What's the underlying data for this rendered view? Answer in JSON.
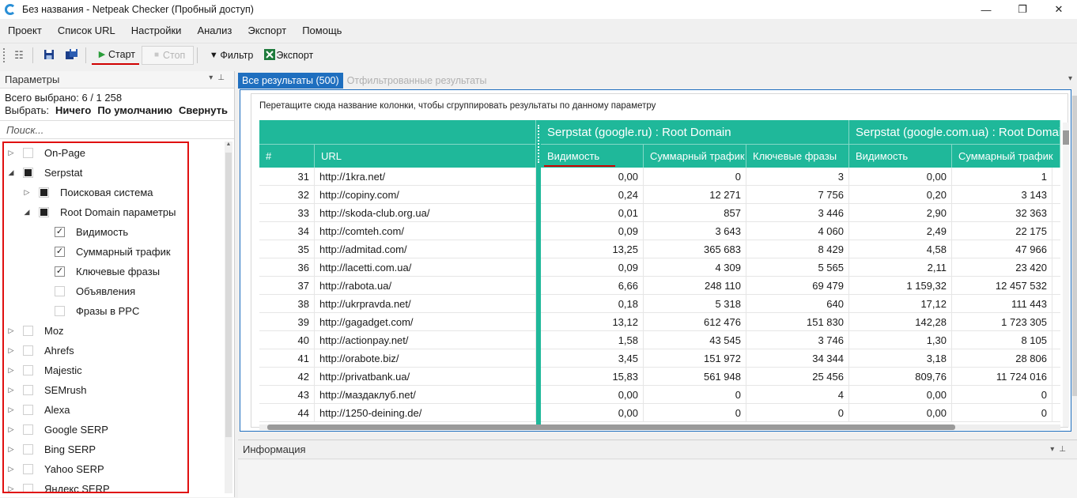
{
  "window": {
    "title": "Без названия - Netpeak Checker (Пробный доступ)",
    "controls": [
      "—",
      "❐",
      "✕"
    ]
  },
  "menu": [
    "Проект",
    "Список URL",
    "Настройки",
    "Анализ",
    "Экспорт",
    "Помощь"
  ],
  "toolbar": {
    "start_label": "Старт",
    "stop_label": "Стоп",
    "filter_label": "Фильтр",
    "export_label": "Экспорт"
  },
  "params_panel": {
    "title": "Параметры",
    "selected_text": "Всего выбрано: 6 / 1 258",
    "select_label": "Выбрать:",
    "select_none": "Ничего",
    "select_default": "По умолчанию",
    "collapse": "Свернуть",
    "search_placeholder": "Поиск...",
    "tree": [
      {
        "label": "On-Page",
        "level": 0,
        "expander": "▷",
        "state": "empty"
      },
      {
        "label": "Serpstat",
        "level": 0,
        "expander": "◢",
        "state": "filled"
      },
      {
        "label": "Поисковая система",
        "level": 1,
        "expander": "▷",
        "state": "filled"
      },
      {
        "label": "Root Domain параметры",
        "level": 1,
        "expander": "◢",
        "state": "filled"
      },
      {
        "label": "Видимость",
        "level": 2,
        "expander": "",
        "state": "checked"
      },
      {
        "label": "Суммарный трафик",
        "level": 2,
        "expander": "",
        "state": "checked"
      },
      {
        "label": "Ключевые фразы",
        "level": 2,
        "expander": "",
        "state": "checked"
      },
      {
        "label": "Объявления",
        "level": 2,
        "expander": "",
        "state": "empty"
      },
      {
        "label": "Фразы в PPC",
        "level": 2,
        "expander": "",
        "state": "empty"
      },
      {
        "label": "Moz",
        "level": 0,
        "expander": "▷",
        "state": "empty"
      },
      {
        "label": "Ahrefs",
        "level": 0,
        "expander": "▷",
        "state": "empty"
      },
      {
        "label": "Majestic",
        "level": 0,
        "expander": "▷",
        "state": "empty"
      },
      {
        "label": "SEMrush",
        "level": 0,
        "expander": "▷",
        "state": "empty"
      },
      {
        "label": "Alexa",
        "level": 0,
        "expander": "▷",
        "state": "empty"
      },
      {
        "label": "Google SERP",
        "level": 0,
        "expander": "▷",
        "state": "empty"
      },
      {
        "label": "Bing SERP",
        "level": 0,
        "expander": "▷",
        "state": "empty"
      },
      {
        "label": "Yahoo SERP",
        "level": 0,
        "expander": "▷",
        "state": "empty"
      },
      {
        "label": "Яндекс SERP",
        "level": 0,
        "expander": "▷",
        "state": "empty"
      }
    ]
  },
  "results": {
    "tab_all": "Все результаты (500)",
    "tab_filtered": "Отфильтрованные результаты",
    "group_hint": "Перетащите сюда название колонки, чтобы сгруппировать результаты по данному параметру",
    "group_headers": [
      "Serpstat (google.ru) : Root Domain",
      "Serpstat (google.com.ua) : Root Domain"
    ],
    "columns": [
      "#",
      "URL",
      "Видимость",
      "Суммарный трафик",
      "Ключевые фразы",
      "Видимость",
      "Суммарный трафик"
    ],
    "rows": [
      [
        "31",
        "http://1kra.net/",
        "0,00",
        "0",
        "3",
        "0,00",
        "1"
      ],
      [
        "32",
        "http://copiny.com/",
        "0,24",
        "12 271",
        "7 756",
        "0,20",
        "3 143"
      ],
      [
        "33",
        "http://skoda-club.org.ua/",
        "0,01",
        "857",
        "3 446",
        "2,90",
        "32 363"
      ],
      [
        "34",
        "http://comteh.com/",
        "0,09",
        "3 643",
        "4 060",
        "2,49",
        "22 175"
      ],
      [
        "35",
        "http://admitad.com/",
        "13,25",
        "365 683",
        "8 429",
        "4,58",
        "47 966"
      ],
      [
        "36",
        "http://lacetti.com.ua/",
        "0,09",
        "4 309",
        "5 565",
        "2,11",
        "23 420"
      ],
      [
        "37",
        "http://rabota.ua/",
        "6,66",
        "248 110",
        "69 479",
        "1 159,32",
        "12 457 532"
      ],
      [
        "38",
        "http://ukrpravda.net/",
        "0,18",
        "5 318",
        "640",
        "17,12",
        "111 443"
      ],
      [
        "39",
        "http://gagadget.com/",
        "13,12",
        "612 476",
        "151 830",
        "142,28",
        "1 723 305"
      ],
      [
        "40",
        "http://actionpay.net/",
        "1,58",
        "43 545",
        "3 746",
        "1,30",
        "8 105"
      ],
      [
        "41",
        "http://orabote.biz/",
        "3,45",
        "151 972",
        "34 344",
        "3,18",
        "28 806"
      ],
      [
        "42",
        "http://privatbank.ua/",
        "15,83",
        "561 948",
        "25 456",
        "809,76",
        "11 724 016"
      ],
      [
        "43",
        "http://маздаклуб.net/",
        "0,00",
        "0",
        "4",
        "0,00",
        "0"
      ],
      [
        "44",
        "http://1250-deining.de/",
        "0,00",
        "0",
        "0",
        "0,00",
        "0"
      ]
    ]
  },
  "info_panel": {
    "title": "Информация"
  },
  "colors": {
    "grid_header": "#1fb89a",
    "tab_active": "#1f6fbf",
    "highlight_red": "#e01010"
  }
}
